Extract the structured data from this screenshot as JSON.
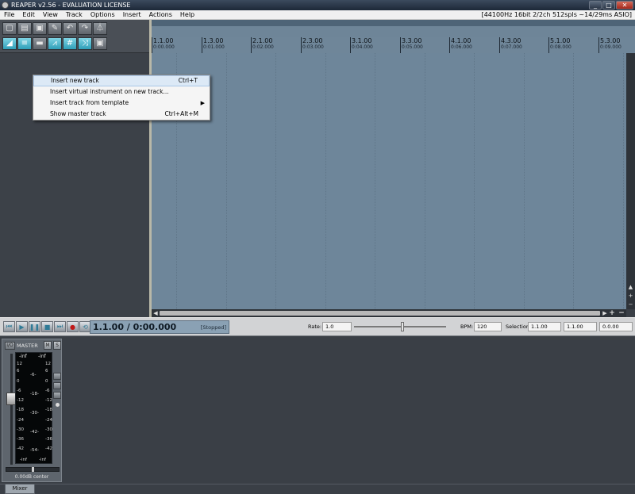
{
  "window": {
    "title": "REAPER v2.56 - EVALUATION LICENSE",
    "buttons": {
      "minimize": "_",
      "maximize": "□",
      "close": "✕"
    }
  },
  "menubar": {
    "items": [
      "File",
      "Edit",
      "View",
      "Track",
      "Options",
      "Insert",
      "Actions",
      "Help"
    ],
    "status": "[44100Hz 16bit 2/2ch 512spls ~14/29ms ASIO]"
  },
  "toolbar": {
    "row1": [
      {
        "icon": "new-project-icon",
        "glyph": "▢"
      },
      {
        "icon": "open-project-icon",
        "glyph": "▤"
      },
      {
        "icon": "save-project-icon",
        "glyph": "▣"
      },
      {
        "icon": "project-settings-icon",
        "glyph": "✎"
      },
      {
        "icon": "undo-icon",
        "glyph": "↶"
      },
      {
        "icon": "redo-icon",
        "glyph": "↷"
      },
      {
        "icon": "metronome-icon",
        "glyph": "⏃"
      }
    ],
    "row2": [
      {
        "icon": "ripple-edit-icon",
        "glyph": "◢",
        "on": true
      },
      {
        "icon": "snap-icon",
        "glyph": "≡",
        "on": true
      },
      {
        "icon": "item-grouping-icon",
        "glyph": "▬",
        "on": false
      },
      {
        "icon": "envelope-points-icon",
        "glyph": "⩘",
        "on": true
      },
      {
        "icon": "grid-icon",
        "glyph": "#",
        "on": true
      },
      {
        "icon": "crossfade-icon",
        "glyph": "⤨",
        "on": true
      },
      {
        "icon": "lock-icon",
        "glyph": "▣",
        "on": false
      }
    ]
  },
  "ruler": {
    "markers": [
      {
        "bar": "1.1.00",
        "time": "0:00.000"
      },
      {
        "bar": "1.3.00",
        "time": "0:01.000"
      },
      {
        "bar": "2.1.00",
        "time": "0:02.000"
      },
      {
        "bar": "2.3.00",
        "time": "0:03.000"
      },
      {
        "bar": "3.1.00",
        "time": "0:04.000"
      },
      {
        "bar": "3.3.00",
        "time": "0:05.000"
      },
      {
        "bar": "4.1.00",
        "time": "0:06.000"
      },
      {
        "bar": "4.3.00",
        "time": "0:07.000"
      },
      {
        "bar": "5.1.00",
        "time": "0:08.000"
      },
      {
        "bar": "5.3.00",
        "time": "0:09.000"
      }
    ]
  },
  "context_menu": {
    "items": [
      {
        "label": "Insert new track",
        "shortcut": "Ctrl+T",
        "highlighted": true,
        "submenu": false
      },
      {
        "label": "Insert virtual instrument on new track...",
        "shortcut": "",
        "highlighted": false,
        "submenu": false
      },
      {
        "label": "Insert track from template",
        "shortcut": "",
        "highlighted": false,
        "submenu": true
      },
      {
        "label": "Show master track",
        "shortcut": "Ctrl+Alt+M",
        "highlighted": false,
        "submenu": false
      }
    ]
  },
  "transport": {
    "position": "1.1.00 / 0:00.000",
    "state": "[Stopped]",
    "rate_label": "Rate:",
    "rate_value": "1.0",
    "bpm_label": "BPM:",
    "bpm_value": "120",
    "selection_label": "Selection:",
    "selection_start": "1.1.00",
    "selection_end": "1.1.00",
    "selection_length": "0.0.00"
  },
  "mixer": {
    "master": {
      "io_label": "I/O",
      "name": "MASTER",
      "mute_label": "M",
      "solo_label": "S",
      "peak_left": "-inf",
      "peak_right": "-inf",
      "scale_outer": [
        "12",
        "6",
        "0",
        "-6",
        "-12",
        "-18",
        "-24",
        "-30",
        "-36",
        "-42"
      ],
      "scale_mid": [
        "-6-",
        "-18-",
        "-30-",
        "-42-",
        "-54-"
      ],
      "bottom_left": "-inf",
      "bottom_right": "-inf",
      "volume_text": "0.00dB center"
    },
    "tab_label": "Mixer"
  },
  "colors": {
    "arrange_bg": "#6e869a",
    "ruler_bg": "#6f8699",
    "toolbar_active": "#2f9fb8",
    "panel_bg": "#3c4148",
    "menu_highlight": "#dce9f6"
  }
}
